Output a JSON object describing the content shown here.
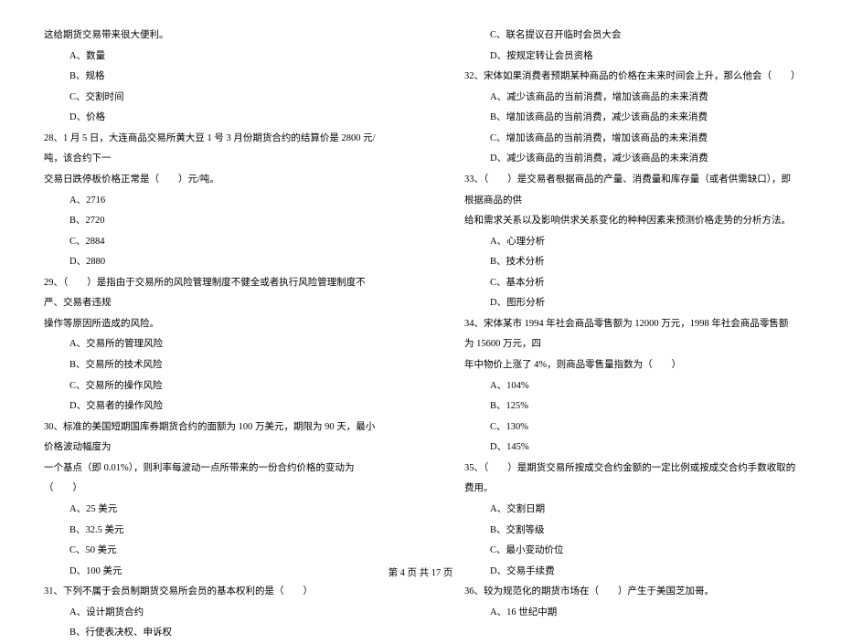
{
  "left": {
    "q27_stem": "这给期货交易带来很大便利。",
    "q27_a": "A、数量",
    "q27_b": "B、规格",
    "q27_c": "C、交割时间",
    "q27_d": "D、价格",
    "q28_line1": "28、1 月 5 日，大连商品交易所黄大豆 1 号 3 月份期货合约的结算价是 2800 元/吨，该合约下一",
    "q28_line2": "交易日跌停板价格正常是（　　）元/吨。",
    "q28_a": "A、2716",
    "q28_b": "B、2720",
    "q28_c": "C、2884",
    "q28_d": "D、2880",
    "q29_line1": "29、（　　）是指由于交易所的风险管理制度不健全或者执行风险管理制度不严、交易者违规",
    "q29_line2": "操作等原因所造成的风险。",
    "q29_a": "A、交易所的管理风险",
    "q29_b": "B、交易所的技术风险",
    "q29_c": "C、交易所的操作风险",
    "q29_d": "D、交易者的操作风险",
    "q30_line1": "30、标准的美国短期国库券期货合约的面额为 100 万美元，期限为 90 天，最小价格波动幅度为",
    "q30_line2": "一个基点（即 0.01%），则利率每波动一点所带来的一份合约价格的变动为（　　）",
    "q30_a": "A、25 美元",
    "q30_b": "B、32.5 美元",
    "q30_c": "C、50 美元",
    "q30_d": "D、100 美元",
    "q31_line1": "31、下列不属于会员制期货交易所会员的基本权利的是（　　）",
    "q31_a": "A、设计期货合约",
    "q31_b": "B、行使表决权、申诉权"
  },
  "right": {
    "q31_c": "C、联名提议召开临时会员大会",
    "q31_d": "D、按规定转让会员资格",
    "q32_line1": "32、宋体如果消费者预期某种商品的价格在未来时间会上升，那么他会（　　）",
    "q32_a": "A、减少该商品的当前消费，增加该商品的未来消费",
    "q32_b": "B、增加该商品的当前消费，减少该商品的未来消费",
    "q32_c": "C、增加该商品的当前消费，增加该商品的未来消费",
    "q32_d": "D、减少该商品的当前消费，减少该商品的未来消费",
    "q33_line1": "33、（　　）是交易者根据商品的产量、消费量和库存量（或者供需缺口），即根据商品的供",
    "q33_line2": "给和需求关系以及影响供求关系变化的种种因素来预测价格走势的分析方法。",
    "q33_a": "A、心理分析",
    "q33_b": "B、技术分析",
    "q33_c": "C、基本分析",
    "q33_d": "D、图形分析",
    "q34_line1": "34、宋体某市 1994 年社会商品零售额为 12000 万元，1998 年社会商品零售额为 15600 万元，四",
    "q34_line2": "年中物价上涨了 4%，则商品零售量指数为（　　）",
    "q34_a": "A、104%",
    "q34_b": "B、125%",
    "q34_c": "C、130%",
    "q34_d": "D、145%",
    "q35_line1": "35、（　　）是期货交易所按成交合约金额的一定比例或按成交合约手数收取的费用。",
    "q35_a": "A、交割日期",
    "q35_b": "B、交割等级",
    "q35_c": "C、最小变动价位",
    "q35_d": "D、交易手续费",
    "q36_line1": "36、较为规范化的期货市场在（　　）产生于美国芝加哥。",
    "q36_a": "A、16 世纪中期"
  },
  "footer": "第 4 页  共 17 页"
}
